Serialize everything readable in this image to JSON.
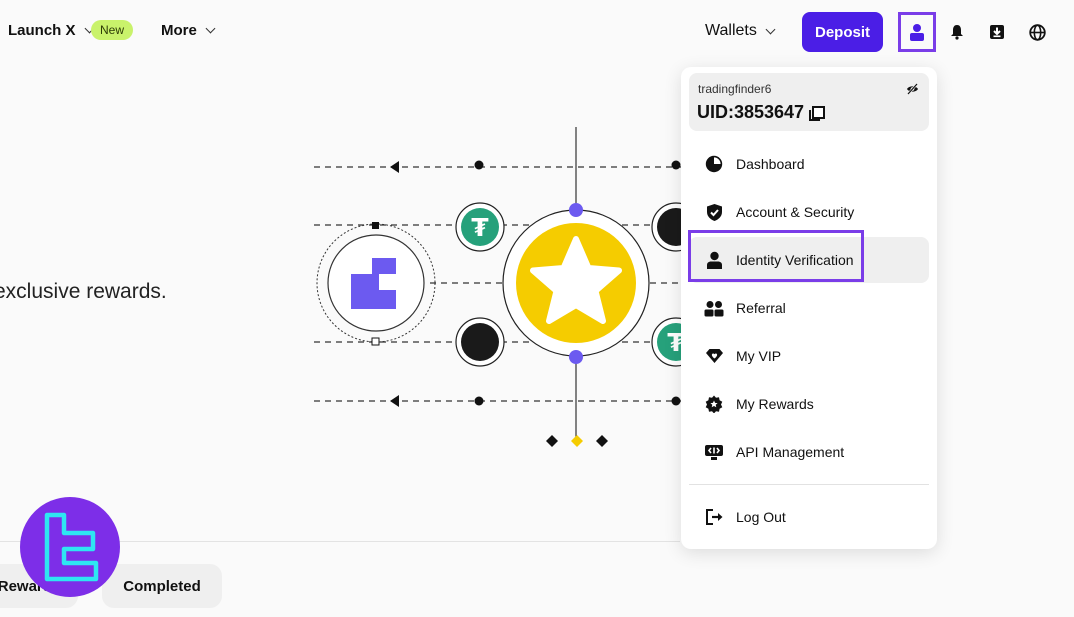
{
  "nav": {
    "launch_label": "Launch X",
    "new_badge": "New",
    "more_label": "More",
    "wallets_label": "Wallets",
    "deposit_label": "Deposit"
  },
  "hero": {
    "text": "exclusive rewards."
  },
  "tabs": [
    {
      "label": "Rewards"
    },
    {
      "label": "Completed"
    }
  ],
  "account": {
    "username": "tradingfinder6",
    "uid": "UID:3853647"
  },
  "menu": {
    "items": [
      {
        "label": "Dashboard",
        "icon": "pie-chart-icon"
      },
      {
        "label": "Account & Security",
        "icon": "shield-check-icon"
      },
      {
        "label": "Identity Verification",
        "icon": "user-icon"
      },
      {
        "label": "Referral",
        "icon": "users-icon"
      },
      {
        "label": "My VIP",
        "icon": "diamond-heart-icon"
      },
      {
        "label": "My Rewards",
        "icon": "gear-badge-icon"
      },
      {
        "label": "API Management",
        "icon": "api-icon"
      }
    ],
    "logout_label": "Log Out"
  },
  "colors": {
    "accent": "#4b1ee6",
    "highlight": "#7a3de8",
    "new_badge": "#c9f26b",
    "tether": "#26a17b",
    "star": "#f5cc00"
  }
}
